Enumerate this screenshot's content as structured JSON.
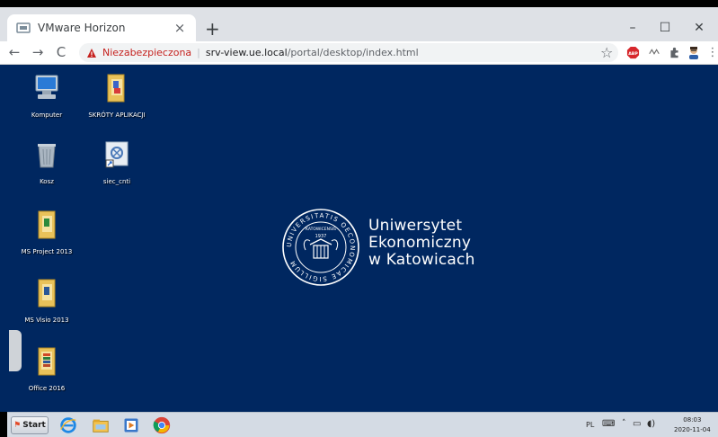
{
  "browser": {
    "tab": {
      "title": "VMware Horizon",
      "close_symbol": "×"
    },
    "new_tab_symbol": "+",
    "window_controls": {
      "minimize": "–",
      "maximize": "☐",
      "close": "✕"
    },
    "nav": {
      "back": "←",
      "forward": "→",
      "reload": "C"
    },
    "address": {
      "security_label": "Niezabezpieczona",
      "url_host": "srv-view.ue.local",
      "url_path": "/portal/desktop/index.html"
    },
    "bookmark_symbol": "☆",
    "extensions": [
      "abp-icon",
      "eye-icon",
      "puzzle-icon",
      "avatar-icon",
      "menu-icon"
    ],
    "abp_label": "ABP"
  },
  "desktop": {
    "background_color": "#002760",
    "icons": [
      {
        "name": "computer",
        "label": "Komputer"
      },
      {
        "name": "shortcuts-folder",
        "label": "SKRÓTY APLIKACJI"
      },
      {
        "name": "recycle-bin",
        "label": "Kosz"
      },
      {
        "name": "siec",
        "label": "siec_cnti"
      },
      {
        "name": "ms-project",
        "label": "MS Project 2013"
      },
      {
        "name": "ms-visio",
        "label": "MS Visio 2013"
      },
      {
        "name": "office",
        "label": "Office 2016"
      }
    ],
    "university": {
      "line1": "Uniwersytet",
      "line2": "Ekonomiczny",
      "line3": "w Katowicach",
      "seal_text": "UNIVERSITATIS OECONOMICAE SIGILLUM",
      "seal_inner": "KATOWICENSIS",
      "seal_year": "1937"
    }
  },
  "taskbar": {
    "start_label": "Start",
    "language": "PL",
    "time": "08:03",
    "date": "2020-11-04"
  }
}
